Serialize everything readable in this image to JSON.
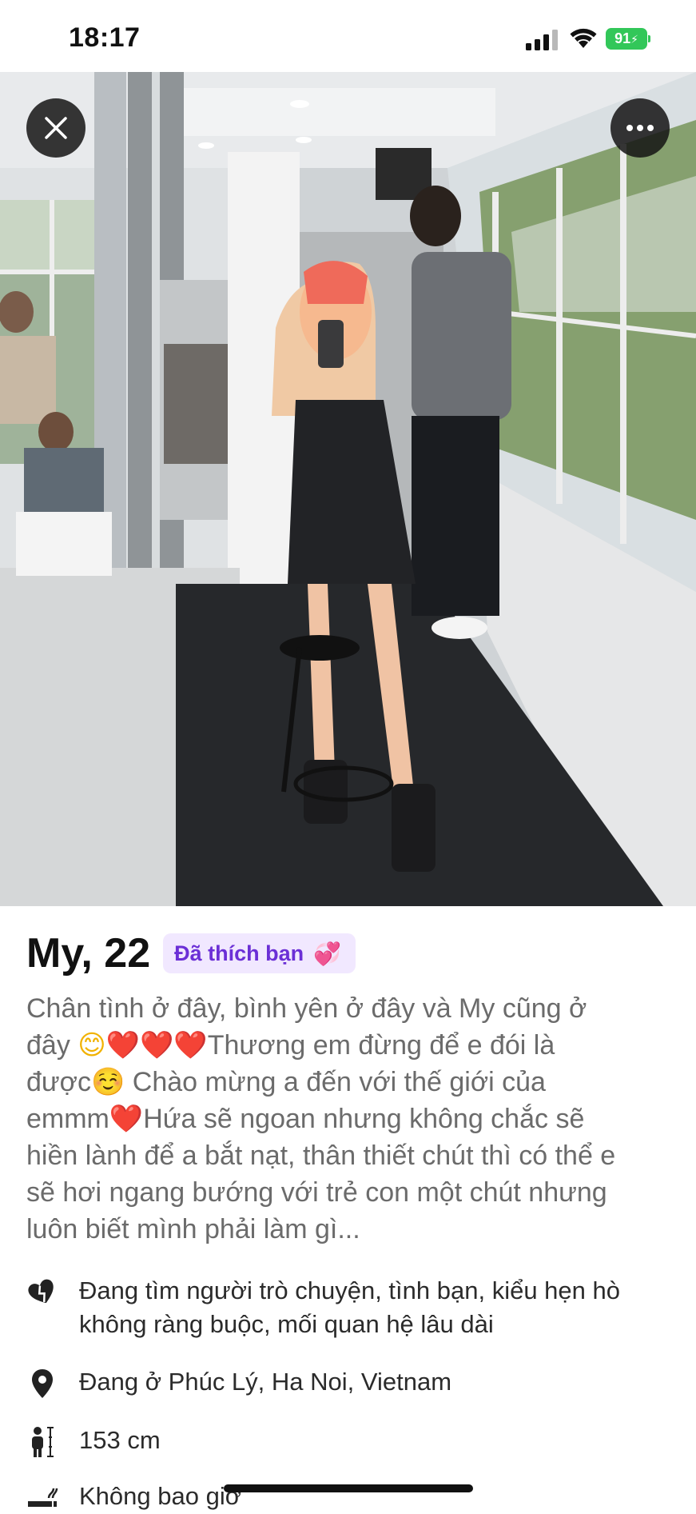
{
  "status_bar": {
    "time": "18:17",
    "battery": "91"
  },
  "photo": {
    "description_icon": "profile-photo"
  },
  "controls": {
    "close_icon": "close-icon",
    "more_icon": "more-icon"
  },
  "profile": {
    "name_age": "My, 22",
    "liked_badge": "Đã thích bạn",
    "bio_lines": [
      "Chân tình ở đây, bình yên ở đây và My cũng ở",
      "đây",
      "Thương em đừng để e đói là",
      "được",
      "Chào mừng a đến với thế giới của",
      "emmm",
      "Hứa sẽ ngoan nhưng không chắc sẽ",
      "hiền lành để a bắt nạt, thân thiết chút thì có thể e",
      "sẽ hơi ngang bướng với trẻ con một chút nhưng",
      "luôn biết mình phải làm gì..."
    ]
  },
  "info": {
    "looking_for_line1": "Đang tìm người trò chuyện, tình bạn, kiểu hẹn hò",
    "looking_for_line2": "không ràng buộc, mối quan hệ lâu dài",
    "location": "Đang ở Phúc Lý, Ha Noi, Vietnam",
    "height": "153 cm",
    "smoking": "Không bao giờ"
  },
  "colors": {
    "badge_bg": "#f1e8ff",
    "badge_text": "#6b2fd6",
    "battery": "#32c759",
    "bio_text": "#6b6b6b"
  }
}
